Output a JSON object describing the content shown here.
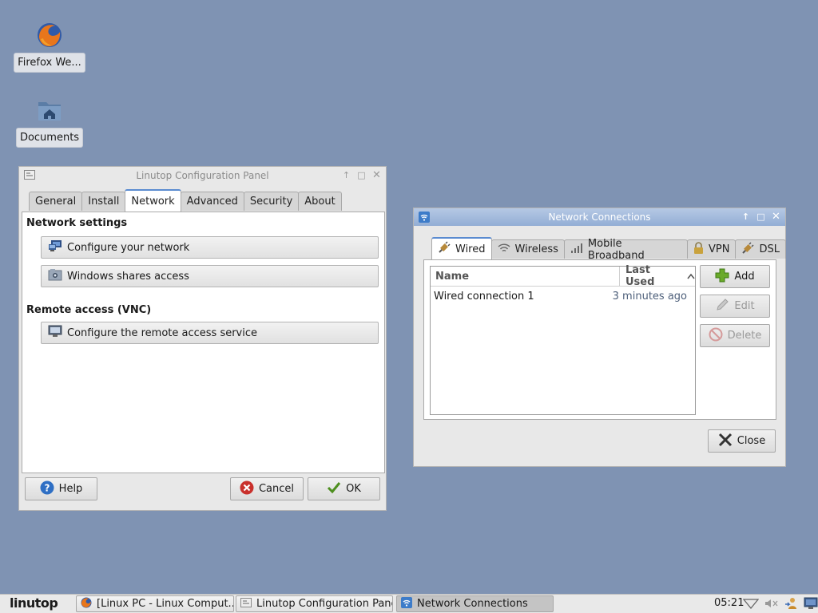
{
  "desktop": {
    "icons": [
      {
        "label": "Firefox We...",
        "icon": "firefox-icon"
      },
      {
        "label": "Documents",
        "icon": "home-folder-icon"
      }
    ]
  },
  "config_panel": {
    "title": "Linutop Configuration Panel",
    "tabs": [
      "General",
      "Install",
      "Network",
      "Advanced",
      "Security",
      "About"
    ],
    "active_tab": "Network",
    "network_settings_heading": "Network settings",
    "configure_network": "Configure your network",
    "windows_shares": "Windows shares access",
    "remote_access_heading": "Remote access (VNC)",
    "configure_remote": "Configure the remote access service",
    "help": "Help",
    "cancel": "Cancel",
    "ok": "OK"
  },
  "network_connections": {
    "title": "Network Connections",
    "tabs": [
      "Wired",
      "Wireless",
      "Mobile Broadband",
      "VPN",
      "DSL"
    ],
    "active_tab": "Wired",
    "columns": {
      "name": "Name",
      "last_used": "Last Used"
    },
    "rows": [
      {
        "name": "Wired connection 1",
        "last_used": "3 minutes ago"
      }
    ],
    "add": "Add",
    "edit": "Edit",
    "delete": "Delete",
    "close": "Close"
  },
  "taskbar": {
    "logo": "linutop",
    "tasks": [
      "[Linux PC - Linux Comput...",
      "Linutop Configuration Panel",
      "Network Connections"
    ],
    "active_task": "Network Connections",
    "clock": "05:21"
  },
  "colors": {
    "desktop": "#7f93b3",
    "active_titlebar": "#9fb6d8",
    "tab_accent": "#5a8bd0"
  }
}
